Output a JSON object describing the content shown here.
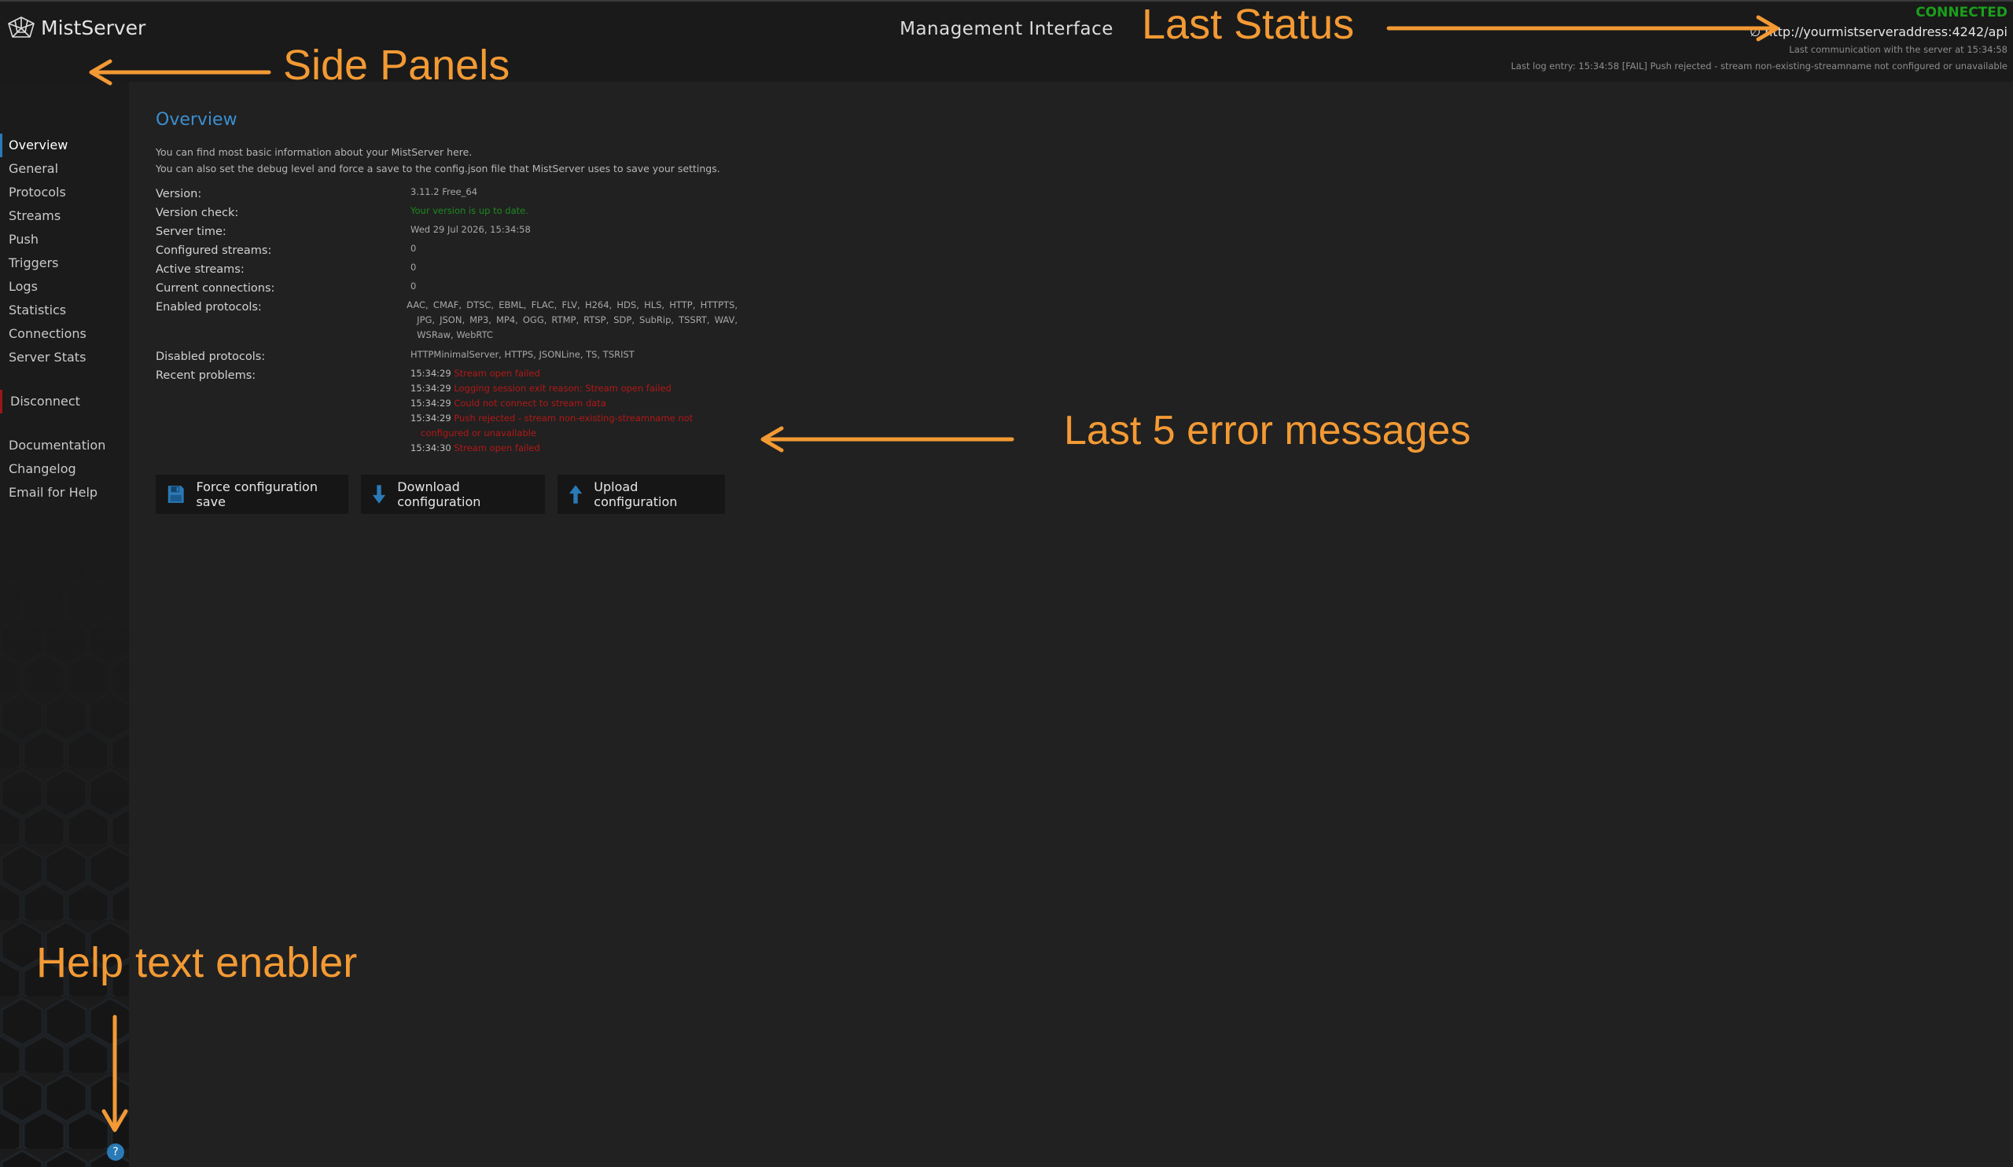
{
  "header": {
    "logo_text": "MistServer",
    "app_title": "Management Interface",
    "status": "CONNECTED",
    "server_url": "∅ http://yourmistserveraddress:4242/api",
    "last_communication": "Last communication with the server at 15:34:58",
    "last_log": "Last log entry: 15:34:58 [FAIL] Push rejected - stream non-existing-streamname not configured or unavailable"
  },
  "sidebar": {
    "primary": [
      {
        "label": "Overview",
        "active": true
      },
      {
        "label": "General"
      },
      {
        "label": "Protocols"
      },
      {
        "label": "Streams"
      },
      {
        "label": "Push"
      },
      {
        "label": "Triggers"
      },
      {
        "label": "Logs"
      },
      {
        "label": "Statistics"
      },
      {
        "label": "Connections"
      },
      {
        "label": "Server Stats"
      }
    ],
    "disconnect": "Disconnect",
    "secondary": [
      {
        "label": "Documentation"
      },
      {
        "label": "Changelog"
      },
      {
        "label": "Email for Help"
      }
    ],
    "help_glyph": "?"
  },
  "overview": {
    "title": "Overview",
    "desc1": "You can find most basic information about your MistServer here.",
    "desc2": "You can also set the debug level and force a save to the config.json file that MistServer uses to save your settings.",
    "rows": {
      "version": {
        "label": "Version:",
        "value": "3.11.2 Free_64"
      },
      "version_check": {
        "label": "Version check:",
        "value": "Your version is up to date."
      },
      "server_time": {
        "label": "Server time:",
        "value": "Wed 29 Jul 2026, 15:34:58"
      },
      "configured_streams": {
        "label": "Configured streams:",
        "value": "0"
      },
      "active_streams": {
        "label": "Active streams:",
        "value": "0"
      },
      "current_connections": {
        "label": "Current connections:",
        "value": "0"
      },
      "enabled_protocols": {
        "label": "Enabled protocols:",
        "value": "AAC, CMAF, DTSC, EBML, FLAC, FLV, H264, HDS, HLS, HTTP, HTTPTS, JPG, JSON, MP3, MP4, OGG, RTMP, RTSP, SDP, SubRip, TSSRT, WAV, WSRaw, WebRTC"
      },
      "disabled_protocols": {
        "label": "Disabled protocols:",
        "value": "HTTPMinimalServer, HTTPS, JSONLine, TS, TSRIST"
      },
      "recent_problems": {
        "label": "Recent problems:"
      }
    },
    "problems": [
      {
        "time": "15:34:29",
        "message": "Stream open failed"
      },
      {
        "time": "15:34:29",
        "message": "Logging session exit reason: Stream open failed"
      },
      {
        "time": "15:34:29",
        "message": "Could not connect to stream data"
      },
      {
        "time": "15:34:29",
        "message": "Push rejected - stream non-existing-streamname not configured or unavailable"
      },
      {
        "time": "15:34:30",
        "message": "Stream open failed"
      }
    ]
  },
  "actions": {
    "force_save": "Force configuration save",
    "download": "Download configuration",
    "upload": "Upload configuration"
  },
  "annotations": {
    "last_status": "Last Status",
    "side_panels": "Side Panels",
    "errors": "Last 5 error messages",
    "help": "Help text enabler"
  },
  "colors": {
    "accent": "#2a7ab7",
    "connected": "#1b9f1b",
    "error": "#b31717",
    "annotation": "#f39a34"
  }
}
